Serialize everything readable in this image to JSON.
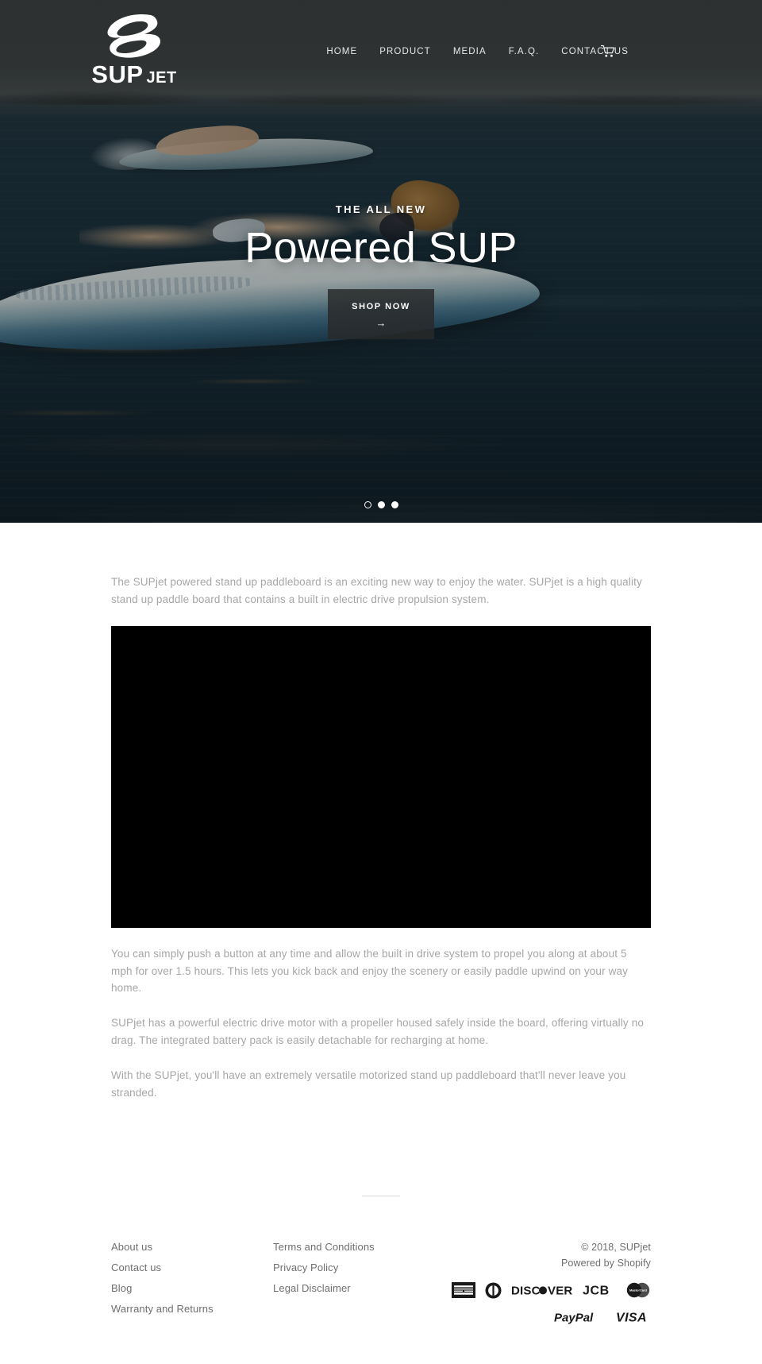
{
  "site": {
    "brand_primary": "SUP",
    "brand_secondary": "JET",
    "logo_icon": "supjet-swoosh-logo"
  },
  "header": {
    "nav": [
      {
        "label": "HOME"
      },
      {
        "label": "PRODUCT"
      },
      {
        "label": "MEDIA"
      },
      {
        "label": "F.A.Q."
      },
      {
        "label": "CONTACT US"
      }
    ],
    "cart_icon": "shopping-cart-icon"
  },
  "hero": {
    "eyebrow": "THE ALL NEW",
    "title": "Powered SUP",
    "cta_label": "SHOP NOW",
    "cta_arrow": "→",
    "slides": [
      {
        "index": 1,
        "active": true
      },
      {
        "index": 2,
        "active": false
      },
      {
        "index": 3,
        "active": false
      }
    ]
  },
  "main": {
    "intro": "The SUPjet powered stand up paddleboard is an exciting new way to enjoy the water. SUPjet is a high quality stand up paddle board that contains a built in electric drive propulsion system.",
    "video_label": "product-video",
    "paragraphs": [
      "You can simply push a button at any time and allow the built in drive system to propel you along at about 5 mph for over 1.5 hours. This lets you kick back and enjoy the scenery or easily paddle upwind on your way home.",
      "SUPjet has a powerful electric drive motor with a propeller housed safely inside the board, offering virtually no drag. The integrated battery pack is easily detachable for recharging at home.",
      "With the SUPjet, you'll have an extremely versatile motorized stand up paddleboard that'll never leave you stranded."
    ]
  },
  "footer": {
    "column_one": [
      {
        "label": "About us"
      },
      {
        "label": "Contact us"
      },
      {
        "label": "Blog"
      },
      {
        "label": "Warranty and Returns"
      }
    ],
    "column_two": [
      {
        "label": "Terms and Conditions"
      },
      {
        "label": "Privacy Policy"
      },
      {
        "label": "Legal Disclaimer"
      }
    ],
    "copyright": "© 2018, SUPjet",
    "powered_prefix": "Powered by ",
    "powered_link": "Shopify",
    "payment_icons_row_one": [
      {
        "name": "american-express-icon",
        "label": "AMERICAN EXPRESS"
      },
      {
        "name": "diners-club-icon",
        "label": "Diners Club"
      },
      {
        "name": "discover-icon",
        "label": "DISCOVER"
      },
      {
        "name": "jcb-icon",
        "label": "JCB"
      },
      {
        "name": "mastercard-icon",
        "label": "MasterCard"
      }
    ],
    "payment_icons_row_two": [
      {
        "name": "paypal-icon",
        "label": "PayPal"
      },
      {
        "name": "visa-icon",
        "label": "VISA"
      }
    ]
  },
  "colors": {
    "hero_overlay": "#11161a",
    "body_text": "#a6a6a6",
    "footer_text": "#6f6f6f",
    "button_bg": "#2a2b2b",
    "video_bg": "#000000"
  }
}
